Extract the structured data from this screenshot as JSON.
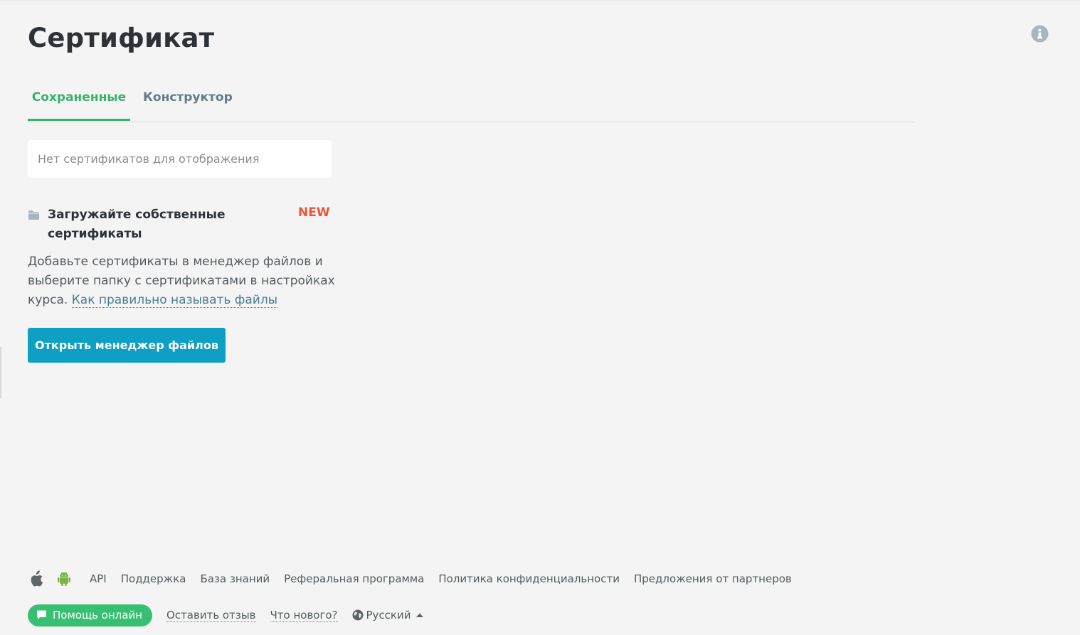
{
  "page": {
    "title": "Сертификат"
  },
  "tabs": [
    {
      "label": "Сохраненные",
      "active": true
    },
    {
      "label": "Конструктор",
      "active": false
    }
  ],
  "empty_state": {
    "text": "Нет сертификатов для отображения"
  },
  "upload": {
    "title": "Загружайте собственные сертификаты",
    "badge": "NEW",
    "description": "Добавьте сертификаты в менеджер файлов и выберите папку с сертификатами в настройках курса.",
    "link_label": "Как правильно называть файлы",
    "button_label": "Открыть менеджер файлов"
  },
  "footer": {
    "links": [
      "API",
      "Поддержка",
      "База знаний",
      "Реферальная программа",
      "Политика конфиденциальности",
      "Предложения от партнеров"
    ],
    "help_label": "Помощь онлайн",
    "feedback_label": "Оставить отзыв",
    "whats_new_label": "Что нового?",
    "language": "Русский"
  },
  "icons": {
    "info": "info-icon",
    "folder": "folder-icon",
    "apple": "apple-icon",
    "android": "android-icon",
    "chat": "chat-icon",
    "globe": "globe-icon",
    "caret": "caret-up-icon"
  },
  "colors": {
    "accent_green": "#37b36b",
    "tab_inactive": "#627d88",
    "new_badge": "#e8553c",
    "primary_button": "#0d9fc4",
    "help_button": "#37c071",
    "link": "#4a7d96"
  }
}
